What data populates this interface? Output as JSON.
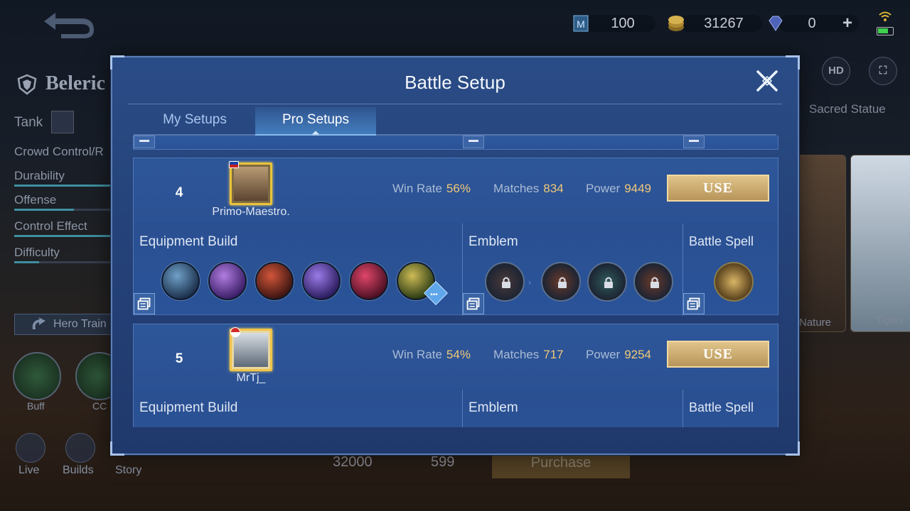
{
  "hud": {
    "tickets": "100",
    "gold": "31267",
    "diamonds": "0",
    "add_label": "+"
  },
  "hero": {
    "name": "Beleric",
    "role": "Tank",
    "specialty": "Crowd Control/R",
    "stats": [
      {
        "label": "Durability",
        "fill": 1.0
      },
      {
        "label": "Offense",
        "fill": 0.6
      },
      {
        "label": "Control Effect",
        "fill": 1.0
      },
      {
        "label": "Difficulty",
        "fill": 0.25
      }
    ],
    "train_label": "Hero Train",
    "skill_labels": [
      "Buff",
      "CC"
    ]
  },
  "bottom_nav": [
    "Live",
    "Builds",
    "Story"
  ],
  "right_panel": {
    "hd_label": "HD",
    "skin_title": "Sacred Statue",
    "skin_card_1": "Nature",
    "skin_card_2": "Tigers"
  },
  "purchase": {
    "gold_price": "32000",
    "diamond_price": "599",
    "button": "Purchase"
  },
  "modal": {
    "title": "Battle Setup",
    "tabs": [
      "My Setups",
      "Pro Setups"
    ],
    "active_tab": "Pro Setups",
    "labels": {
      "win_rate": "Win Rate",
      "matches": "Matches",
      "power": "Power",
      "use": "USE",
      "equipment": "Equipment Build",
      "emblem": "Emblem",
      "spell": "Battle Spell"
    },
    "setups": [
      {
        "rank": "4",
        "player": "Primo-Maestro.",
        "win_rate": "56%",
        "matches": "834",
        "power": "9449",
        "items": [
          {
            "icon": "warrior-boots-icon",
            "c1": "#6fa0c8",
            "c2": "#1b2f4a"
          },
          {
            "icon": "dominance-ice-icon",
            "c1": "#b07de0",
            "c2": "#3b1d66"
          },
          {
            "icon": "cursed-helmet-icon",
            "c1": "#d2553a",
            "c2": "#3a1410"
          },
          {
            "icon": "athenas-shield-icon",
            "c1": "#9b7be8",
            "c2": "#2a1b5c"
          },
          {
            "icon": "radiant-armor-icon",
            "c1": "#e0466a",
            "c2": "#4a0f22"
          },
          {
            "icon": "guardian-helmet-icon",
            "c1": "#cdbb55",
            "c2": "#2a3a14"
          }
        ],
        "emblems": [
          "emblem-main-icon",
          "emblem-talent-1-icon",
          "emblem-talent-2-icon",
          "emblem-talent-3-icon"
        ],
        "spell": "vengeance-spell-icon"
      },
      {
        "rank": "5",
        "player": "MrTj_",
        "win_rate": "54%",
        "matches": "717",
        "power": "9254"
      }
    ]
  }
}
